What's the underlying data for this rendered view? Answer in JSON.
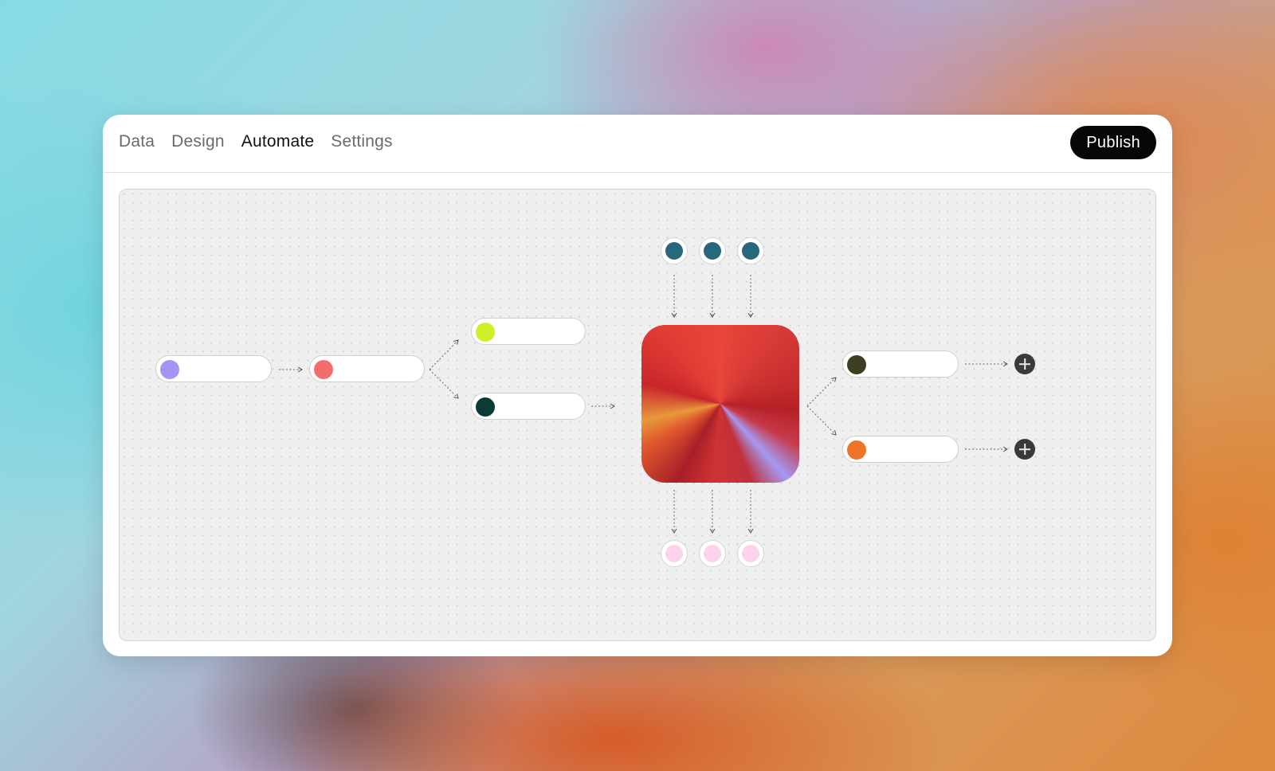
{
  "tabs": [
    {
      "label": "Data",
      "active": false
    },
    {
      "label": "Design",
      "active": false
    },
    {
      "label": "Automate",
      "active": true
    },
    {
      "label": "Settings",
      "active": false
    }
  ],
  "publish_label": "Publish",
  "colors": {
    "pill_purple": "#a596f6",
    "pill_coral": "#f46d6d",
    "pill_lime": "#cdf02a",
    "pill_darkteal": "#0c3b35",
    "top_node": "#27687f",
    "bottom_node": "#ffd2ec",
    "pill_olive": "#3e3f22",
    "pill_orange": "#ed7428",
    "plus": "#3a3a3a"
  },
  "icons": [
    "plus-icon"
  ]
}
